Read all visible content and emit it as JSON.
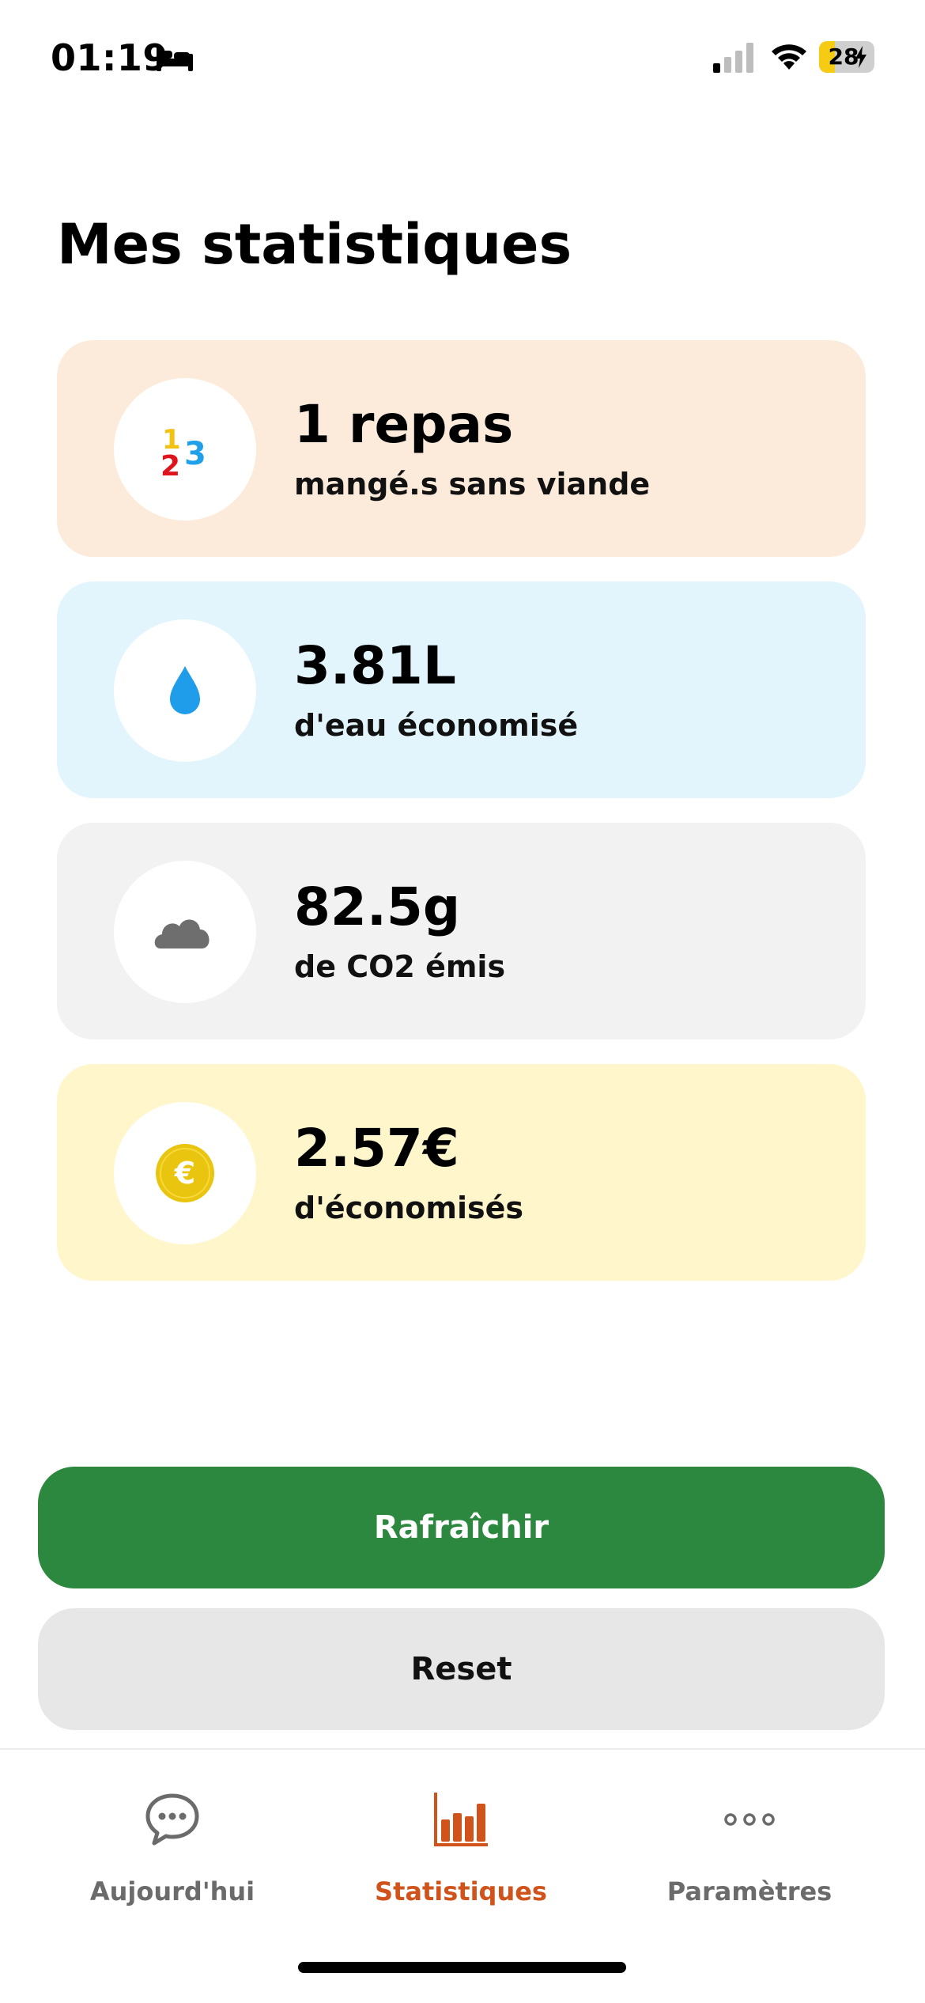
{
  "status_bar": {
    "time": "01:19",
    "battery_level": "28",
    "icons": [
      "bed-icon",
      "cellular-signal-icon",
      "wifi-icon",
      "battery-charging-icon"
    ]
  },
  "page": {
    "title": "Mes statistiques"
  },
  "stats": [
    {
      "value": "1 repas",
      "label": "mangé.s sans viande",
      "icon": "numbers-123-icon",
      "color": "#fcebdb"
    },
    {
      "value": "3.81L",
      "label": "d'eau économisé",
      "icon": "water-drop-icon",
      "color": "#e2f5fc"
    },
    {
      "value": "82.5g",
      "label": "de CO2 émis",
      "icon": "cloud-icon",
      "color": "#f2f2f2"
    },
    {
      "value": "2.57€",
      "label": "d'économisés",
      "icon": "euro-coin-icon",
      "color": "#fff6cc"
    }
  ],
  "actions": {
    "refresh_label": "Rafraîchir",
    "reset_label": "Reset"
  },
  "tab_bar": {
    "active": "Statistiques",
    "tabs": [
      {
        "label": "Aujourd'hui",
        "icon": "chat-bubble-icon"
      },
      {
        "label": "Statistiques",
        "icon": "bar-chart-icon"
      },
      {
        "label": "Paramètres",
        "icon": "more-dots-icon"
      }
    ]
  },
  "colors": {
    "accent_green": "#2c873f",
    "active_tab": "#d0531b",
    "inactive_tab": "#6b6b6b"
  }
}
